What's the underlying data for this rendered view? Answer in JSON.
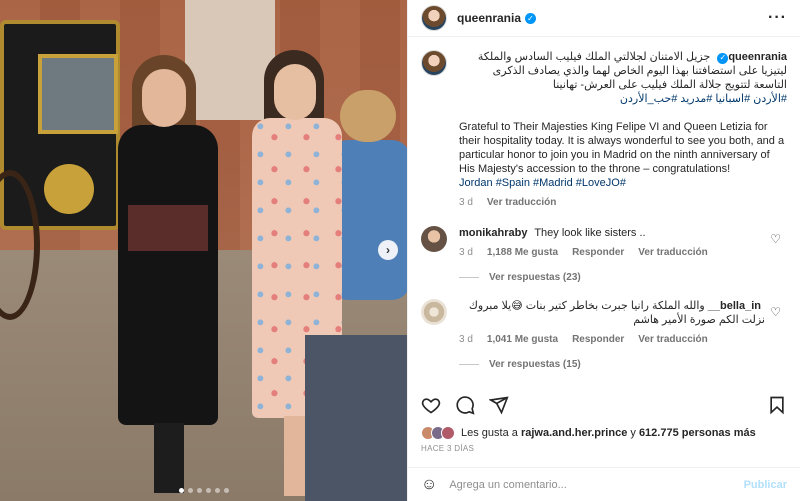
{
  "post": {
    "username": "queenrania",
    "verified_mark": "✓",
    "more_icon": "···",
    "caption_ar": "جزيل الامتنان لجلالتي الملك فيليب السادس والملكة ليتيزيا على استضافتنا بهذا اليوم الخاص لهما والذي يصادف الذكرى التاسعة لتتويج جلالة الملك فيليب على العرش- تهانينا",
    "caption_ar_tags": "#الأردن #اسبانيا #مدريد #حب_الأردن",
    "caption_en": "Grateful to Their Majesties King Felipe VI and Queen Letizia for their hospitality today. It is always wonderful to see you both, and a particular honor to join you in Madrid on the ninth anniversary of His Majesty's accession to the throne – congratulations!",
    "caption_en_tags": "Jordan #Spain #Madrid #LoveJO#",
    "caption_time": "3 d",
    "see_translation": "Ver traducción"
  },
  "comments": [
    {
      "user": "monikahraby",
      "text": "They look like sisters ..",
      "time": "3 d",
      "likes": "1,188 Me gusta",
      "reply": "Responder",
      "translate": "Ver traducción",
      "view_replies": "Ver respuestas (23)"
    },
    {
      "user": "bella_in__",
      "text": "والله الملكة رانيا جبرت بخاطر كتير بنات 😅يلا مبروك نزلت الكم صورة الأمير هاشم",
      "time": "3 d",
      "likes": "1,041 Me gusta",
      "reply": "Responder",
      "translate": "Ver traducción",
      "view_replies": "Ver respuestas (15)"
    }
  ],
  "likes": {
    "prefix": "Les gusta a",
    "user": "rajwa.and.her.prince",
    "connector": "y",
    "count": "612.775 personas más"
  },
  "date": "HACE 3 DÍAS",
  "composer": {
    "placeholder": "Agrega un comentario...",
    "publish": "Publicar",
    "emoji": "☺"
  },
  "carousel": {
    "slides": 6,
    "active": 0
  },
  "icons": {
    "heart": "heart-icon",
    "comment": "comment-icon",
    "share": "share-icon",
    "save": "bookmark-icon"
  },
  "colors": {
    "verified": "#0095f6",
    "hashtag": "#00376b",
    "publish": "#b2dffc"
  }
}
